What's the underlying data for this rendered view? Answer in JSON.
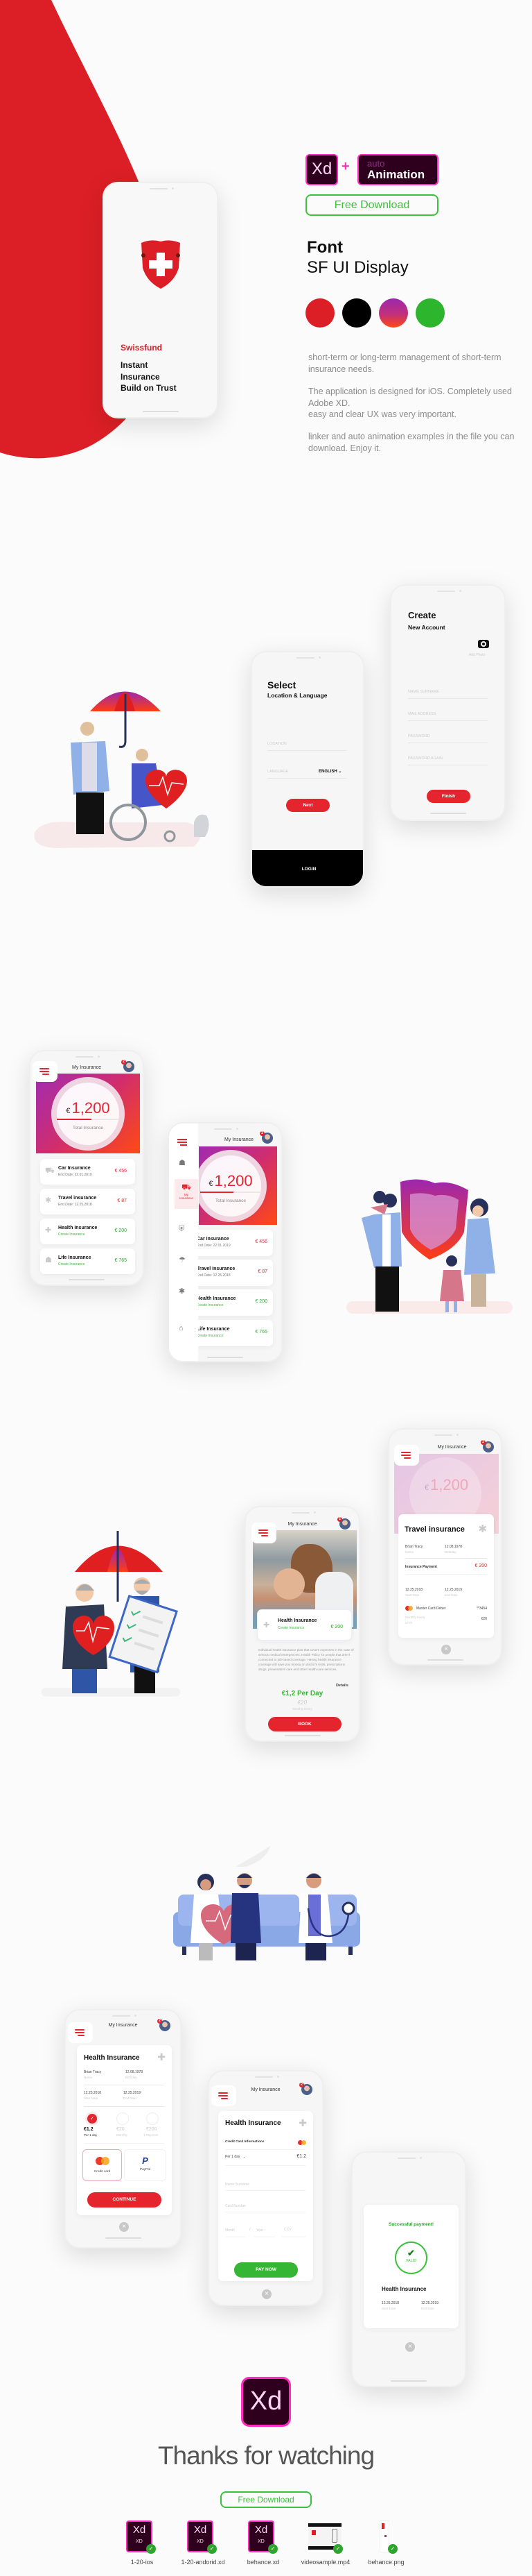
{
  "hero": {
    "brand": "Swissfund",
    "line1": "Instant",
    "line2": "Insurance",
    "line3": "Build on Trust"
  },
  "tools": {
    "xd": "Xd",
    "plus": "+",
    "auto": "auto",
    "animation": "Animation",
    "download": "Free Download"
  },
  "font": {
    "label": "Font",
    "name": "SF UI Display"
  },
  "palette": {
    "red": "#dc1f26",
    "black": "#000000",
    "gradient_top": "#9c27b0",
    "gradient_bottom": "#ff4a12",
    "green": "#2db52d"
  },
  "description": {
    "p1": "short-term or long-term management of short-term insurance needs.",
    "p2": "The application is designed for iOS. Completely used Adobe XD.",
    "p2b": "easy and clear UX was very important.",
    "p3": "linker and auto animation examples in the file you can download. Enjoy it."
  },
  "select": {
    "title": "Select",
    "subtitle": "Location & Language",
    "location": "LOCATION",
    "language": "LANGUAGE",
    "language_value": "ENGLISH",
    "next": "Next",
    "login": "LOGIN"
  },
  "create": {
    "title": "Create",
    "subtitle": "New Account",
    "add_photo": "Add Photo",
    "fields": [
      "NAME SURNAME",
      "MAIL ADDRESS",
      "PASSWORD",
      "PASSWORD AGAIN"
    ],
    "finish": "Finish"
  },
  "dashboard": {
    "header": "My Insurance",
    "notifications": "2",
    "currency": "€",
    "total": "1,200",
    "total_label": "Total Insurance",
    "progress": 0.55,
    "sidebar_active": "My Insurance",
    "items": [
      {
        "name": "Car Insurance",
        "sub": "End Date: 22.01.2019",
        "amount": "€ 456"
      },
      {
        "name": "Travel insurance",
        "sub": "End Date: 12.25.2018",
        "amount": "€ 87"
      },
      {
        "name": "Health Insurance",
        "sub": "Create Insurance",
        "amount": "€ 200"
      },
      {
        "name": "Life Insurance",
        "sub": "Create Insurance",
        "amount": "€ 765"
      }
    ]
  },
  "health": {
    "title": "Health Insurance",
    "sub": "Create Insurance",
    "amount": "€ 200",
    "description": "Individual health insurance plan that covers expenses in the case of serious medical emergencies. Health Policy for people that aren't connected to job-based coverage. Having health insurance coverage will save you money on doctor's visits, prescriptions drugs, preventative care and other health-care services.",
    "details": "Details",
    "per_day": "€1,2 Per Day",
    "monthly_price": "€20",
    "monthly_label": "Monthly Every",
    "book": "BOOK"
  },
  "travel": {
    "title": "Travel insurance",
    "name": "Brian Tracy",
    "name_label": "Name",
    "birthday": "12.08.1978",
    "birthday_label": "Birthday",
    "payment_label": "Insurance Payment",
    "payment": "€ 200",
    "start": "12.25.2018",
    "start_label": "Start Date",
    "end": "12.25.2019",
    "end_label": "End Date",
    "card": "Master Card Debet",
    "card_number": "**3454",
    "monthly_label": "Monthly Every",
    "monthly_day": "27 th",
    "monthly_amount": "€20"
  },
  "plan": {
    "title": "Health Insurance",
    "name": "Brian Tracy",
    "name_label": "Name",
    "birthday": "12.08.1978",
    "birthday_label": "Birthday",
    "start": "12.25.2018",
    "start_label": "Start Date",
    "end": "12.25.2019",
    "end_label": "End Date",
    "options": [
      {
        "price": "€1.2",
        "label": "Per 1 day",
        "selected": true
      },
      {
        "price": "€20",
        "label": "Monthly",
        "selected": false
      },
      {
        "price": "€200",
        "label": "1 Payment",
        "selected": false
      }
    ],
    "credit": "Credit card",
    "paypal": "PayPal",
    "continue": "CONTINUE"
  },
  "pay": {
    "title": "Health Insurance",
    "cc_info": "Credit Card Informations",
    "period": "Per 1 day",
    "price": "€1.2",
    "name_ph": "Name Surname",
    "card_ph": "Card Number",
    "month_ph": "Month",
    "sep": "/",
    "year_ph": "Year",
    "ccv_ph": "CCV",
    "pay": "PAY NOW"
  },
  "success": {
    "message": "Successful payment!",
    "valid": "VALID",
    "title": "Health Insurance",
    "start": "12.25.2018",
    "start_label": "Start Date",
    "end": "12.25.2019",
    "end_label": "End Date"
  },
  "footer": {
    "xd": "Xd",
    "thanks": "Thanks for watching",
    "download": "Free Download",
    "files": [
      {
        "name": "1-20-ios",
        "type": "XD"
      },
      {
        "name": "1-20-andorid.xd",
        "type": "XD"
      },
      {
        "name": "behance.xd",
        "type": "XD"
      },
      {
        "name": "videosample.mp4"
      },
      {
        "name": "behance.png"
      }
    ]
  }
}
